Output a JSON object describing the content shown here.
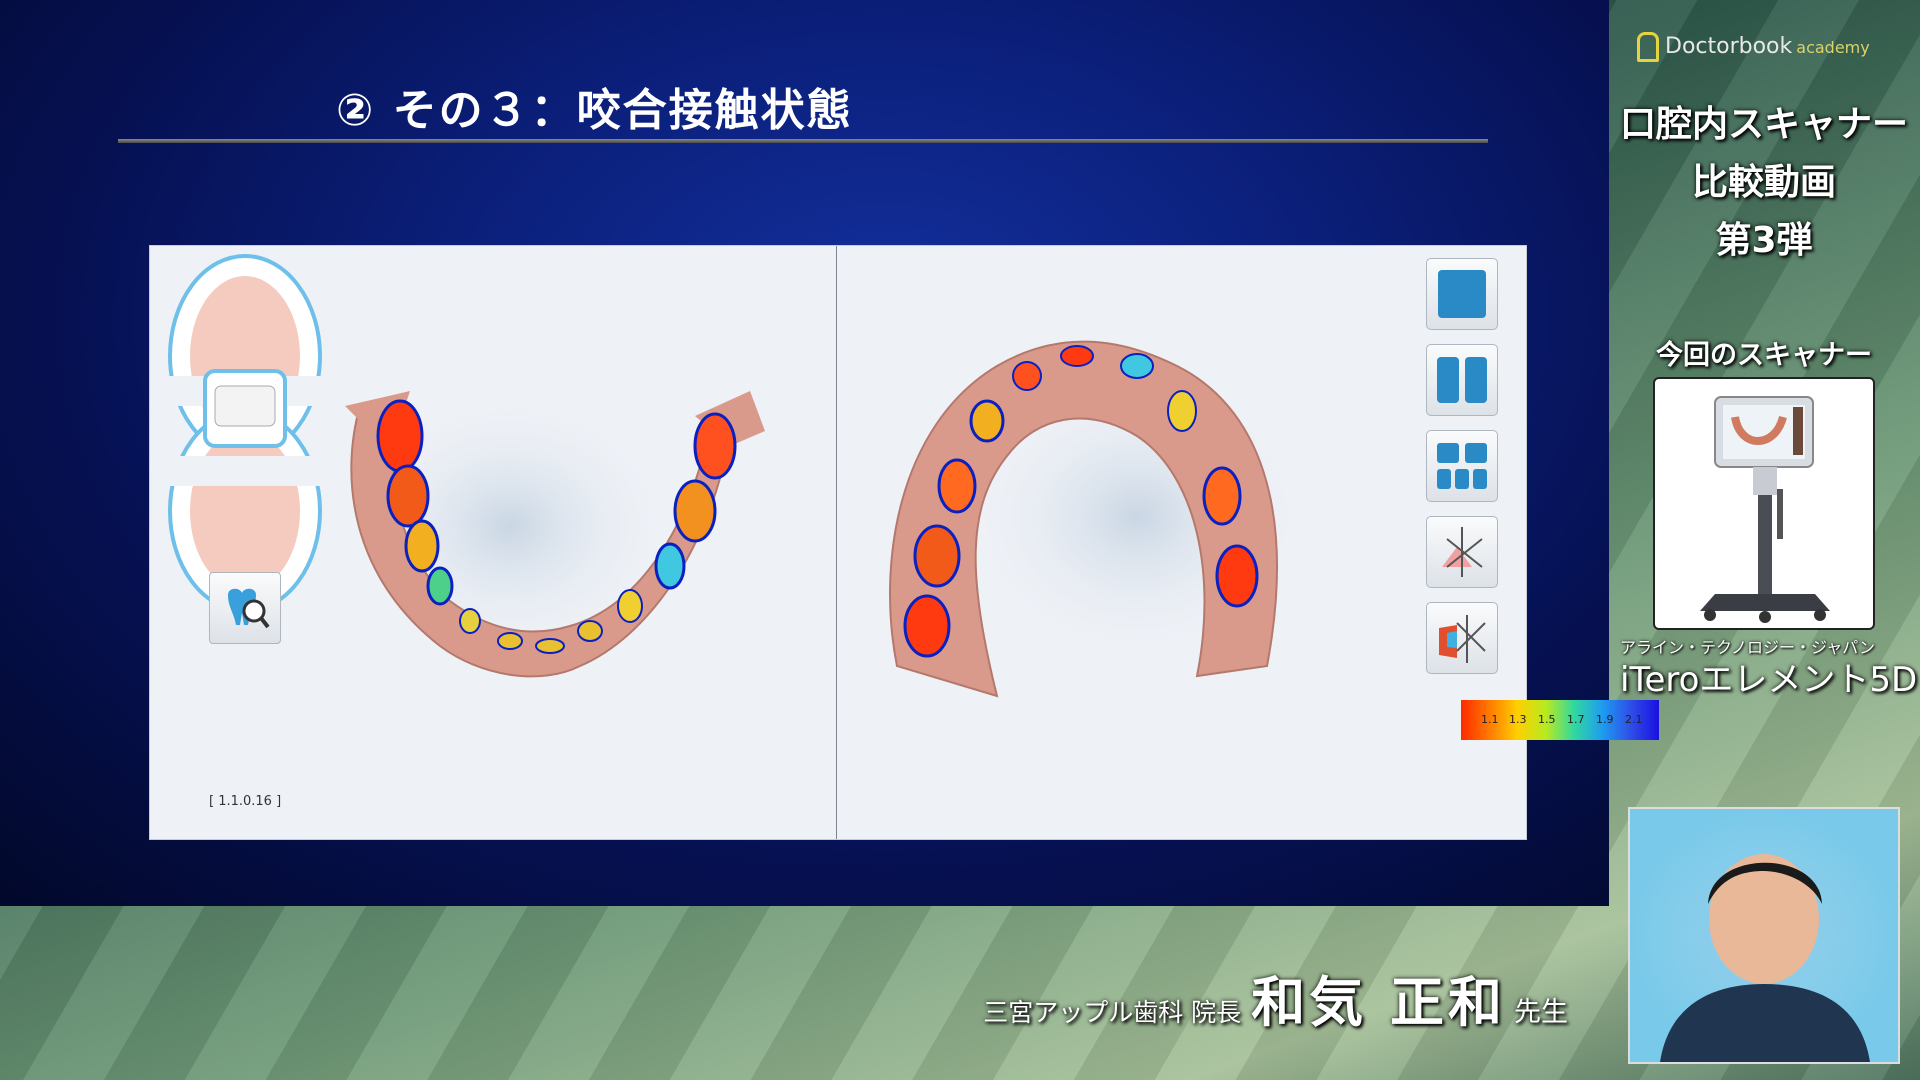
{
  "slide": {
    "title": "② その３：咬合接触状態"
  },
  "viewer": {
    "version": "[ 1.1.0.16 ]",
    "legend_values": [
      "1.1",
      "1.3",
      "1.5",
      "1.7",
      "1.9",
      "2.1"
    ],
    "tools": [
      "single-view-icon",
      "dual-view-icon",
      "quad-view-icon",
      "bite-analysis-icon",
      "occlusogram-icon"
    ]
  },
  "sidebar": {
    "logo_text": "Doctorbook",
    "logo_sub": "academy",
    "title_line1": "口腔内スキャナー",
    "title_line2": "比較動画",
    "title_line3": "第3弾",
    "scanner_heading": "今回のスキャナー",
    "maker": "アライン・テクノロジー・ジャパン",
    "product": "iTeroエレメント5D"
  },
  "presenter": {
    "affiliation": "三宮アップル歯科 院長",
    "name": "和気 正和",
    "honorific": "先生"
  }
}
